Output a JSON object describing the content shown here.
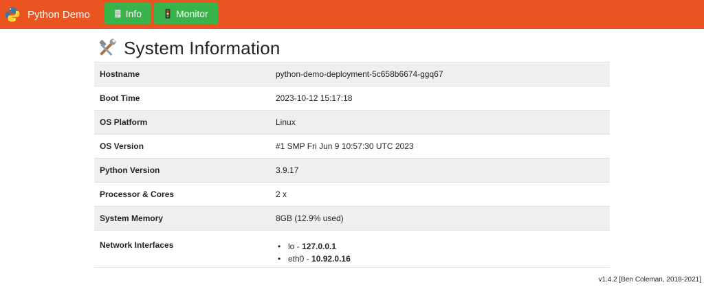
{
  "navbar": {
    "brand": "Python Demo",
    "brand_icon": "python-logo-icon",
    "color": "#e95420",
    "buttons": [
      {
        "label": "Info",
        "icon": "document-icon"
      },
      {
        "label": "Monitor",
        "icon": "traffic-light-icon"
      }
    ],
    "button_color": "#38b44a"
  },
  "page": {
    "title": "System Information",
    "title_icon": "tools-icon"
  },
  "table": {
    "rows": [
      {
        "key": "Hostname",
        "value": "python-demo-deployment-5c658b6674-ggq67"
      },
      {
        "key": "Boot Time",
        "value": "2023-10-12 15:17:18"
      },
      {
        "key": "OS Platform",
        "value": "Linux"
      },
      {
        "key": "OS Version",
        "value": "#1 SMP Fri Jun 9 10:57:30 UTC 2023"
      },
      {
        "key": "Python Version",
        "value": "3.9.17"
      },
      {
        "key": "Processor & Cores",
        "value": "2 x"
      },
      {
        "key": "System Memory",
        "value": "8GB (12.9% used)"
      }
    ],
    "network": {
      "key": "Network Interfaces",
      "interfaces": [
        {
          "name": "lo",
          "sep": " - ",
          "ip": "127.0.0.1"
        },
        {
          "name": "eth0",
          "sep": " - ",
          "ip": "10.92.0.16"
        }
      ]
    }
  },
  "footer": "v1.4.2 [Ben Coleman, 2018-2021]"
}
